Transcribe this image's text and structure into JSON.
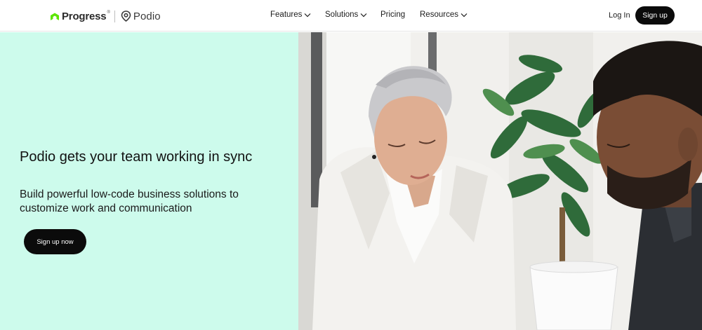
{
  "header": {
    "brand": {
      "progress_label": "Progress",
      "trademark": "®",
      "podio_label": "Podio",
      "progress_color": "#5ce500",
      "podio_icon": "podio-pin-icon"
    },
    "nav": [
      {
        "label": "Features",
        "has_dropdown": true
      },
      {
        "label": "Solutions",
        "has_dropdown": true
      },
      {
        "label": "Pricing",
        "has_dropdown": false
      },
      {
        "label": "Resources",
        "has_dropdown": true
      }
    ],
    "login_label": "Log In",
    "signup_label": "Sign up"
  },
  "hero": {
    "title": "Podio gets your team working in sync",
    "subtitle": "Build powerful low-code business solutions to customize work and communication",
    "cta_label": "Sign up now",
    "background_color": "#cdfbec",
    "photo": "office-team-photo"
  }
}
